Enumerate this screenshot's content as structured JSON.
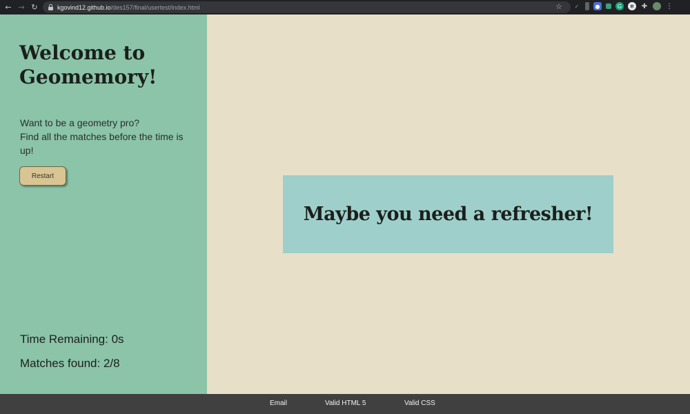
{
  "browser": {
    "url_host": "kgovind12.github.io",
    "url_path": "/des157/final/usertest/index.html",
    "icons": [
      "back-arrow-icon",
      "forward-arrow-icon",
      "reload-icon",
      "lock-icon",
      "star-icon",
      "extensions-puzzle-icon",
      "profile-avatar-icon"
    ]
  },
  "sidebar": {
    "title": "Welcome to Geomemory!",
    "intro_line1": "Want to be a geometry pro?",
    "intro_line2": "Find all the matches before the time is up!",
    "restart_label": "Restart",
    "time_remaining": "Time Remaining: 0s",
    "matches_found": "Matches found: 2/8"
  },
  "main": {
    "message": "Maybe you need a refresher!"
  },
  "footer": {
    "links": [
      "Email",
      "Valid HTML 5",
      "Valid CSS"
    ]
  },
  "colors": {
    "sidebar_bg": "#8bc4a8",
    "main_bg": "#e8dfc8",
    "message_bg": "#9ecfcb",
    "button_bg": "#d9c594",
    "footer_bg": "#404040"
  }
}
